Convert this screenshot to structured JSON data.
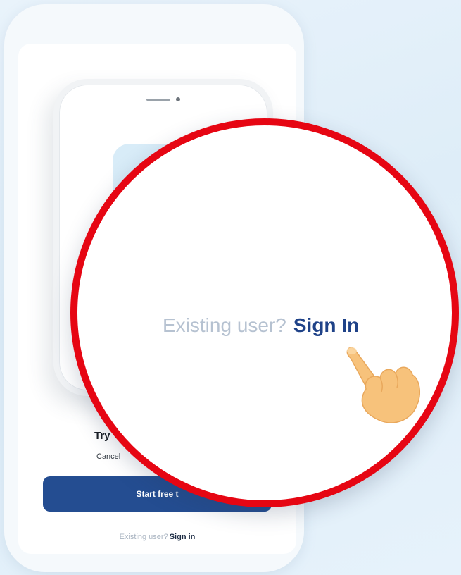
{
  "onboarding": {
    "title_partial": "Try",
    "subtitle_partial": "Cancel",
    "start_button_partial": "Start free t",
    "existing_user_text": "Existing user?",
    "sign_in_text": "Sign in"
  },
  "zoom": {
    "existing_user_text": "Existing user?",
    "sign_in_text": "Sign In"
  },
  "colors": {
    "background": "#e4f0fa",
    "primary_button": "#244d91",
    "sign_in_link": "#1f4288",
    "muted_text": "#b6c2d1",
    "highlight_ring": "#e60613",
    "hand": "#f7c27b"
  },
  "icons": {
    "pointer": "pointing-hand-icon"
  }
}
